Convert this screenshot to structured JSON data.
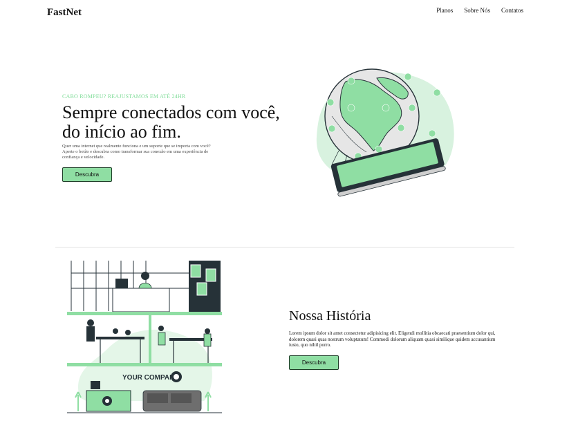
{
  "brand": "FastNet",
  "nav": {
    "items": [
      "Planos",
      "Sobre Nós",
      "Contatos"
    ]
  },
  "hero": {
    "kicker": "CABO ROMPEU? REAJUSTAMOS EM ATÉ 24HR",
    "title": "Sempre conectados com você, do início ao fim.",
    "text": "Quer uma internet que realmente funciona e um suporte que se importa com você? Aperte o botão e descubra como transformar sua conexão em uma experiência de confiança e velocidade.",
    "button": "Descubra"
  },
  "history": {
    "title": "Nossa História",
    "text": "Lorem ipsum dolor sit amet consectetur adipisicing elit. Eligendi mollitia obcaecati praesentium dolor qui, dolorem quasi quas nostrum voluptatum! Commodi dolorum aliquam quasi similique quidem accusantium iusto, quo nihil porro.",
    "button": "Descubra",
    "illustration_sign": "YOUR COMPANY"
  },
  "colors": {
    "accent": "#8fdea3",
    "accent_text": "#7fdc98",
    "dark": "#263238"
  }
}
